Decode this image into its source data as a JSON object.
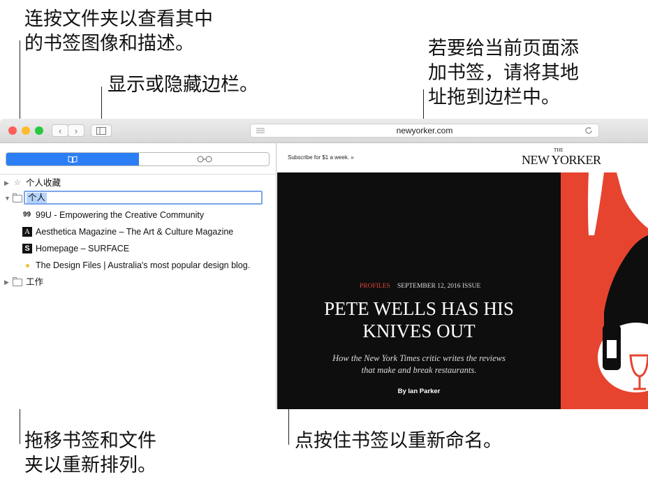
{
  "callouts": {
    "top_left": "连按文件夹以查看其中\n的书签图像和描述。",
    "sidebar_toggle": "显示或隐藏边栏。",
    "top_right": "若要给当前页面添\n加书签，请将其地\n址拖到边栏中。",
    "bottom_left": "拖移书签和文件\n夹以重新排列。",
    "bottom_right": "点按住书签以重新命名。"
  },
  "toolbar": {
    "back_label": "‹",
    "forward_label": "›",
    "address": "newyorker.com",
    "reader_icon": "reader-lines-icon",
    "reload_icon": "reload-icon"
  },
  "sidebar": {
    "tabs": {
      "bookmarks_icon": "book-icon",
      "reading_list_icon": "glasses-icon"
    },
    "favorites_label": "个人收藏",
    "personal_folder_name": "个人",
    "bookmarks": [
      {
        "icon_text": "99",
        "title": "99U - Empowering the Creative Community"
      },
      {
        "icon_text": "A",
        "title": "Aesthetica Magazine – The Art & Culture Magazine"
      },
      {
        "icon_text": "S",
        "title": "Homepage – SURFACE"
      },
      {
        "icon_text": "",
        "title": "The Design Files | Australia's most popular design blog."
      }
    ],
    "work_folder_label": "工作"
  },
  "page": {
    "subscribe": "Subscribe for $1 a week. »",
    "logo_small": "THE",
    "logo": "NEW YORKER",
    "section": "PROFILES",
    "issue": "SEPTEMBER 12, 2016 ISSUE",
    "headline_1": "PETE WELLS HAS HIS",
    "headline_2": "KNIVES OUT",
    "dek_1": "How the New York Times critic writes the reviews",
    "dek_2": "that make and break restaurants.",
    "byline": "By Ian Parker"
  },
  "colors": {
    "accent": "#2c7ef5",
    "close": "#fc5f57",
    "minimize": "#fdbc2e",
    "zoom": "#28c840",
    "hero_bg": "#0e0e0e",
    "art_red": "#e6442f",
    "section_red": "#e0443a"
  }
}
